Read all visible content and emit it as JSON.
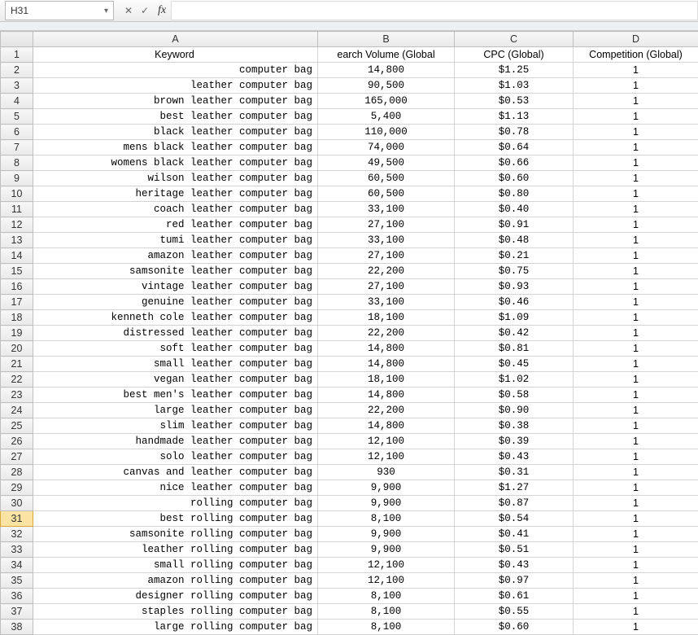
{
  "formula_bar": {
    "cell_ref": "H31",
    "fx_label": "fx",
    "formula_value": ""
  },
  "columns": {
    "A": "A",
    "B": "B",
    "C": "C",
    "D": "D"
  },
  "header_row": {
    "A": "Keyword",
    "B": "earch Volume (Global",
    "C": "CPC (Global)",
    "D": "Competition (Global)"
  },
  "active_row": 31,
  "rows": [
    {
      "n": 2,
      "A": "computer bag",
      "B": "14,800",
      "C": "$1.25",
      "D": "1"
    },
    {
      "n": 3,
      "A": "leather computer bag",
      "B": "90,500",
      "C": "$1.03",
      "D": "1"
    },
    {
      "n": 4,
      "A": "brown leather computer bag",
      "B": "165,000",
      "C": "$0.53",
      "D": "1"
    },
    {
      "n": 5,
      "A": "best leather computer bag",
      "B": "5,400",
      "C": "$1.13",
      "D": "1"
    },
    {
      "n": 6,
      "A": "black leather computer bag",
      "B": "110,000",
      "C": "$0.78",
      "D": "1"
    },
    {
      "n": 7,
      "A": "mens black leather computer bag",
      "B": "74,000",
      "C": "$0.64",
      "D": "1"
    },
    {
      "n": 8,
      "A": "womens black leather computer bag",
      "B": "49,500",
      "C": "$0.66",
      "D": "1"
    },
    {
      "n": 9,
      "A": "wilson leather computer bag",
      "B": "60,500",
      "C": "$0.60",
      "D": "1"
    },
    {
      "n": 10,
      "A": "heritage leather computer bag",
      "B": "60,500",
      "C": "$0.80",
      "D": "1"
    },
    {
      "n": 11,
      "A": "coach leather computer bag",
      "B": "33,100",
      "C": "$0.40",
      "D": "1"
    },
    {
      "n": 12,
      "A": "red leather computer bag",
      "B": "27,100",
      "C": "$0.91",
      "D": "1"
    },
    {
      "n": 13,
      "A": "tumi leather computer bag",
      "B": "33,100",
      "C": "$0.48",
      "D": "1"
    },
    {
      "n": 14,
      "A": "amazon leather computer bag",
      "B": "27,100",
      "C": "$0.21",
      "D": "1"
    },
    {
      "n": 15,
      "A": "samsonite leather computer bag",
      "B": "22,200",
      "C": "$0.75",
      "D": "1"
    },
    {
      "n": 16,
      "A": "vintage leather computer bag",
      "B": "27,100",
      "C": "$0.93",
      "D": "1"
    },
    {
      "n": 17,
      "A": "genuine leather computer bag",
      "B": "33,100",
      "C": "$0.46",
      "D": "1"
    },
    {
      "n": 18,
      "A": "kenneth cole leather computer bag",
      "B": "18,100",
      "C": "$1.09",
      "D": "1"
    },
    {
      "n": 19,
      "A": "distressed leather computer bag",
      "B": "22,200",
      "C": "$0.42",
      "D": "1"
    },
    {
      "n": 20,
      "A": "soft leather computer bag",
      "B": "14,800",
      "C": "$0.81",
      "D": "1"
    },
    {
      "n": 21,
      "A": "small leather computer bag",
      "B": "14,800",
      "C": "$0.45",
      "D": "1"
    },
    {
      "n": 22,
      "A": "vegan leather computer bag",
      "B": "18,100",
      "C": "$1.02",
      "D": "1"
    },
    {
      "n": 23,
      "A": "best men's leather computer bag",
      "B": "14,800",
      "C": "$0.58",
      "D": "1"
    },
    {
      "n": 24,
      "A": "large leather computer bag",
      "B": "22,200",
      "C": "$0.90",
      "D": "1"
    },
    {
      "n": 25,
      "A": "slim leather computer bag",
      "B": "14,800",
      "C": "$0.38",
      "D": "1"
    },
    {
      "n": 26,
      "A": "handmade leather computer bag",
      "B": "12,100",
      "C": "$0.39",
      "D": "1"
    },
    {
      "n": 27,
      "A": "solo leather computer bag",
      "B": "12,100",
      "C": "$0.43",
      "D": "1"
    },
    {
      "n": 28,
      "A": "canvas and leather computer bag",
      "B": "930",
      "C": "$0.31",
      "D": "1"
    },
    {
      "n": 29,
      "A": "nice leather computer bag",
      "B": "9,900",
      "C": "$1.27",
      "D": "1"
    },
    {
      "n": 30,
      "A": "rolling computer bag",
      "B": "9,900",
      "C": "$0.87",
      "D": "1"
    },
    {
      "n": 31,
      "A": "best rolling computer bag",
      "B": "8,100",
      "C": "$0.54",
      "D": "1"
    },
    {
      "n": 32,
      "A": "samsonite rolling computer bag",
      "B": "9,900",
      "C": "$0.41",
      "D": "1"
    },
    {
      "n": 33,
      "A": "leather rolling computer bag",
      "B": "9,900",
      "C": "$0.51",
      "D": "1"
    },
    {
      "n": 34,
      "A": "small rolling computer bag",
      "B": "12,100",
      "C": "$0.43",
      "D": "1"
    },
    {
      "n": 35,
      "A": "amazon rolling computer bag",
      "B": "12,100",
      "C": "$0.97",
      "D": "1"
    },
    {
      "n": 36,
      "A": "designer rolling computer bag",
      "B": "8,100",
      "C": "$0.61",
      "D": "1"
    },
    {
      "n": 37,
      "A": "staples rolling computer bag",
      "B": "8,100",
      "C": "$0.55",
      "D": "1"
    },
    {
      "n": 38,
      "A": "large rolling computer bag",
      "B": "8,100",
      "C": "$0.60",
      "D": "1"
    }
  ]
}
